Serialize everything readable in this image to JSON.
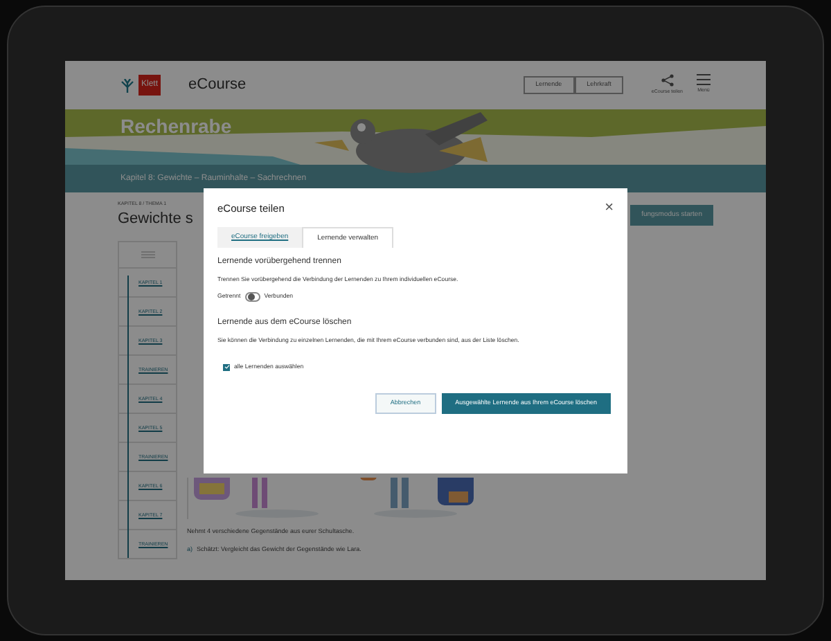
{
  "header": {
    "logo": "Klett",
    "product": "eCourse",
    "roles": [
      {
        "label": "Lernende",
        "selected": false
      },
      {
        "label": "Lehrkraft",
        "selected": false
      }
    ],
    "actions": [
      {
        "kind": "share",
        "label": "eCourse teilen"
      },
      {
        "kind": "menu",
        "label": "Menü"
      }
    ]
  },
  "banner": {
    "title": "Rechenrabe",
    "chapter": "Kapitel 8: Gewichte – Rauminhalte – Sachrechnen"
  },
  "content": {
    "breadcrumb": "KAPITEL 8 / THEMA 1",
    "heading": "Gewichte s",
    "start_button": "fungsmodus starten",
    "sidebar": [
      "KAPITEL 1",
      "KAPITEL 2",
      "KAPITEL 3",
      "TRAINIEREN",
      "KAPITEL 4",
      "KAPITEL 5",
      "TRAINIEREN",
      "KAPITEL 6",
      "KAPITEL 7",
      "TRAINIEREN"
    ],
    "task": "Nehmt 4 verschiedene Gegenstände aus eurer Schultasche.",
    "subtask_label": "a)",
    "subtask": "Schätzt: Vergleicht das Gewicht der Gegenstände wie Lara."
  },
  "dialog": {
    "title": "eCourse teilen",
    "close": "×",
    "tabs": [
      {
        "label": "eCourse freigeben",
        "selected": false
      },
      {
        "label": "Lernende verwalten",
        "selected": true
      }
    ],
    "disconnect": {
      "heading": "Lernende vorübergehend trennen",
      "text": "Trennen Sie vorübergehend die Verbindung der Lernenden zu Ihrem individuellen eCourse.",
      "off_label": "Getrennt",
      "on_label": "Verbunden",
      "on": false
    },
    "remove": {
      "heading": "Lernende aus dem eCourse löschen",
      "text": "Sie können die Verbindung zu einzelnen Lernenden, die mit Ihrem eCourse verbunden sind, aus der Liste löschen.",
      "select_all": "alle Lernenden auswählen",
      "checked": true
    },
    "buttons": [
      {
        "kind": "secondary",
        "label": "Abbrechen"
      },
      {
        "kind": "primary",
        "label": "Ausgewählte Lernende aus Ihrem eCourse löschen"
      }
    ]
  }
}
